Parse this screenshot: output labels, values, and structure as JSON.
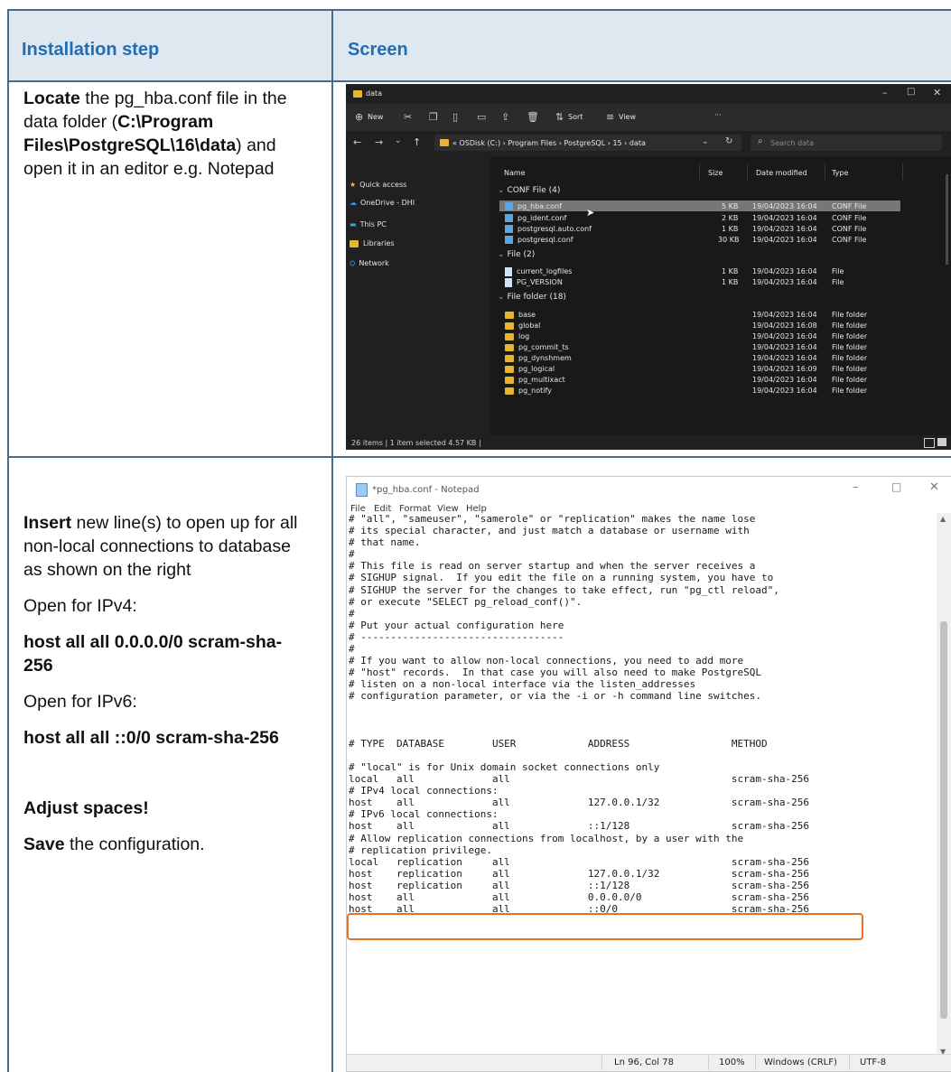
{
  "table": {
    "header_step": "Installation step",
    "header_screen": "Screen"
  },
  "step1": {
    "bold1": "Locate",
    "text1": " the pg_hba.conf file in the data folder (",
    "bold2": "C:\\Program Files\\PostgreSQL\\16\\data",
    "text2": ") and open it in an editor e.g. Notepad"
  },
  "step2": {
    "bold1": "Insert",
    "text1": " new line(s) to open up for all non-local connections to database as shown on the right",
    "ipv4_label": "Open for IPv4:",
    "ipv4_cmd": "host all all 0.0.0.0/0 scram-sha-256",
    "ipv6_label": "Open for IPv6:",
    "ipv6_cmd": "host all all ::0/0 scram-sha-256",
    "adjust": "Adjust spaces!",
    "save_bold": "Save",
    "save_text": " the configuration."
  },
  "explorer": {
    "title": "data",
    "toolbar": {
      "new": "New",
      "sort": "Sort",
      "view": "View",
      "more": "···"
    },
    "breadcrumb": "«  OSDisk (C:)  ›  Program Files  ›  PostgreSQL  ›  15  ›  data",
    "search_placeholder": "Search data",
    "nav": [
      "Quick access",
      "OneDrive - DHI",
      "This PC",
      "Libraries",
      "Network"
    ],
    "columns": {
      "name": "Name",
      "size": "Size",
      "date": "Date modified",
      "type": "Type"
    },
    "groups": [
      {
        "label": "CONF File (4)",
        "items": [
          {
            "name": "pg_hba.conf",
            "size": "5 KB",
            "date": "19/04/2023 16:04",
            "type": "CONF File"
          },
          {
            "name": "pg_ident.conf",
            "size": "2 KB",
            "date": "19/04/2023 16:04",
            "type": "CONF File"
          },
          {
            "name": "postgresql.auto.conf",
            "size": "1 KB",
            "date": "19/04/2023 16:04",
            "type": "CONF File"
          },
          {
            "name": "postgresql.conf",
            "size": "30 KB",
            "date": "19/04/2023 16:04",
            "type": "CONF File"
          }
        ]
      },
      {
        "label": "File (2)",
        "items": [
          {
            "name": "current_logfiles",
            "size": "1 KB",
            "date": "19/04/2023 16:04",
            "type": "File"
          },
          {
            "name": "PG_VERSION",
            "size": "1 KB",
            "date": "19/04/2023 16:04",
            "type": "File"
          }
        ]
      },
      {
        "label": "File folder (18)",
        "items": [
          {
            "name": "base",
            "size": "",
            "date": "19/04/2023 16:04",
            "type": "File folder"
          },
          {
            "name": "global",
            "size": "",
            "date": "19/04/2023 16:08",
            "type": "File folder"
          },
          {
            "name": "log",
            "size": "",
            "date": "19/04/2023 16:04",
            "type": "File folder"
          },
          {
            "name": "pg_commit_ts",
            "size": "",
            "date": "19/04/2023 16:04",
            "type": "File folder"
          },
          {
            "name": "pg_dynshmem",
            "size": "",
            "date": "19/04/2023 16:04",
            "type": "File folder"
          },
          {
            "name": "pg_logical",
            "size": "",
            "date": "19/04/2023 16:09",
            "type": "File folder"
          },
          {
            "name": "pg_multixact",
            "size": "",
            "date": "19/04/2023 16:04",
            "type": "File folder"
          },
          {
            "name": "pg_notify",
            "size": "",
            "date": "19/04/2023 16:04",
            "type": "File folder"
          }
        ]
      }
    ],
    "status": "26 items  |  1 item selected  4.57 KB  |"
  },
  "notepad": {
    "title": "*pg_hba.conf - Notepad",
    "menu": [
      "File",
      "Edit",
      "Format",
      "View",
      "Help"
    ],
    "lines": [
      "# \"all\", \"sameuser\", \"samerole\" or \"replication\" makes the name lose",
      "# its special character, and just match a database or username with",
      "# that name.",
      "#",
      "# This file is read on server startup and when the server receives a",
      "# SIGHUP signal.  If you edit the file on a running system, you have to",
      "# SIGHUP the server for the changes to take effect, run \"pg_ctl reload\",",
      "# or execute \"SELECT pg_reload_conf()\".",
      "#",
      "# Put your actual configuration here",
      "# ----------------------------------",
      "#",
      "# If you want to allow non-local connections, you need to add more",
      "# \"host\" records.  In that case you will also need to make PostgreSQL",
      "# listen on a non-local interface via the listen_addresses",
      "# configuration parameter, or via the -i or -h command line switches.",
      "",
      "",
      "",
      "# TYPE  DATABASE        USER            ADDRESS                 METHOD",
      "",
      "# \"local\" is for Unix domain socket connections only",
      "local   all             all                                     scram-sha-256",
      "# IPv4 local connections:",
      "host    all             all             127.0.0.1/32            scram-sha-256",
      "# IPv6 local connections:",
      "host    all             all             ::1/128                 scram-sha-256",
      "# Allow replication connections from localhost, by a user with the",
      "# replication privilege.",
      "local   replication     all                                     scram-sha-256",
      "host    replication     all             127.0.0.1/32            scram-sha-256",
      "host    replication     all             ::1/128                 scram-sha-256",
      "host    all             all             0.0.0.0/0               scram-sha-256",
      "host    all             all             ::0/0                   scram-sha-256"
    ],
    "status": {
      "position": "Ln 96, Col 78",
      "zoom": "100%",
      "eol": "Windows (CRLF)",
      "encoding": "UTF-8"
    }
  }
}
